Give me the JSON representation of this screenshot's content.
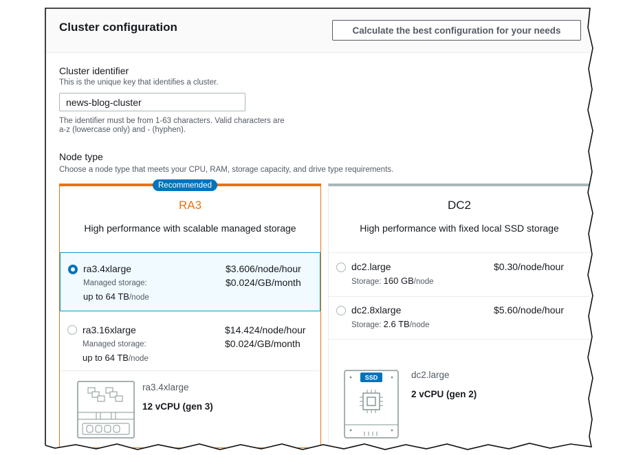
{
  "header": {
    "title": "Cluster configuration",
    "calc_button": "Calculate the best configuration for your needs"
  },
  "cluster_identifier": {
    "label": "Cluster identifier",
    "description": "This is the unique key that identifies a cluster.",
    "value": "news-blog-cluster",
    "hint_line1": "The identifier must be from 1-63 characters. Valid characters are",
    "hint_line2": "a-z (lowercase only) and - (hyphen)."
  },
  "node_type": {
    "label": "Node type",
    "description": "Choose a node type that meets your CPU, RAM, storage capacity, and drive type requirements.",
    "ra3": {
      "badge": "Recommended",
      "title": "RA3",
      "subtitle": "High performance with scalable managed storage",
      "options": [
        {
          "name": "ra3.4xlarge",
          "price": "$3.606/node/hour",
          "storage_label": "Managed storage:",
          "storage_price": "$0.024/GB/month",
          "storage_value": "up to 64 TB",
          "storage_unit": "/node",
          "selected": true
        },
        {
          "name": "ra3.16xlarge",
          "price": "$14.424/node/hour",
          "storage_label": "Managed storage:",
          "storage_price": "$0.024/GB/month",
          "storage_value": "up to 64 TB",
          "storage_unit": "/node",
          "selected": false
        }
      ],
      "summary": {
        "name": "ra3.4xlarge",
        "vcpu": "12 vCPU (gen 3)"
      }
    },
    "dc2": {
      "title": "DC2",
      "subtitle": "High performance with fixed local SSD storage",
      "options": [
        {
          "name": "dc2.large",
          "price": "$0.30/node/hour",
          "storage_label": "Storage: ",
          "storage_value": "160 GB",
          "storage_unit": "/node",
          "selected": false
        },
        {
          "name": "dc2.8xlarge",
          "price": "$5.60/node/hour",
          "storage_label": "Storage: ",
          "storage_value": "2.6 TB",
          "storage_unit": "/node",
          "selected": false
        }
      ],
      "summary": {
        "name": "dc2.large",
        "vcpu": "2 vCPU (gen 2)",
        "ssd_label": "SSD"
      }
    }
  },
  "colors": {
    "accent_orange": "#ec7211",
    "accent_blue": "#0073bb",
    "selected_bg": "#f1faff",
    "selected_border": "#00a1c9"
  }
}
